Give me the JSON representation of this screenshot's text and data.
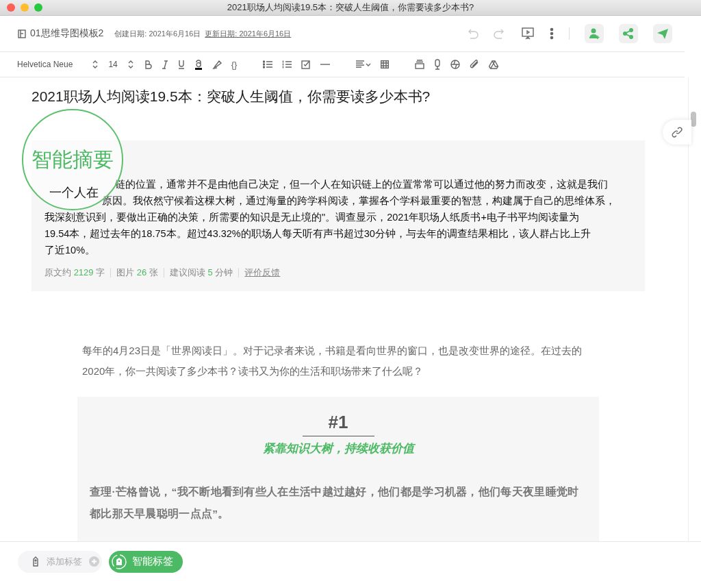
{
  "window": {
    "title": "2021职场人均阅读19.5本：突破人生阈值，你需要读多少本书?"
  },
  "header": {
    "notebook": "01思维导图模板2",
    "created": "创建日期: 2021年6月16日",
    "updated": "更新日期: 2021年6月16日"
  },
  "toolbar": {
    "font": "Helvetica Neue",
    "size": "14",
    "code": "{}"
  },
  "note": {
    "title": "2021职场人均阅读19.5本：突破人生阈值，你需要读多少本书?",
    "summary": {
      "badge": "智能摘要",
      "overlay": "一个人在",
      "lines": [
        "链的位置，通常并不是由他自己决定，但一个人在知识链上的位置常常可以通过他的努力而改变，这就是我们",
        "原因。我依然守候着这棵大树，通过海量的跨学科阅读，掌握各个学科最重要的智慧，构建属于自己的思维体系，",
        "我深刻意识到，要做出正确的决策，所需要的知识是无止境的\"。调查显示，2021年职场人纸质书+电子书平均阅读量为",
        "19.54本，超过去年的18.75本。超过43.32%的职场人每天听有声书超过30分钟，与去年的调查结果相比，该人群占比上升",
        "了近10%。"
      ],
      "stats": [
        {
          "label": "原文约",
          "value": "2129",
          "unit": "字"
        },
        {
          "label": "图片",
          "value": "26",
          "unit": "张"
        },
        {
          "label": "建议阅读",
          "value": "5",
          "unit": "分钟"
        }
      ],
      "feedback": "评价反馈"
    },
    "intro": "每年的4月23日是「世界阅读日」。对于记录者来说，书籍是看向世界的窗口，也是改变世界的途径。在过去的2020年，你一共阅读了多少本书？读书又为你的生活和职场带来了什么呢？",
    "section": {
      "number": "#1",
      "subtitle": "紧靠知识大树，持续收获价值",
      "quote": "查理·芒格曾说，“我不断地看到有些人在生活中越过越好，他们都是学习机器，他们每天夜里睡觉时都比那天早晨聪明一点点”。"
    }
  },
  "tags": {
    "add": "添加标签",
    "smart": "智能标签"
  }
}
